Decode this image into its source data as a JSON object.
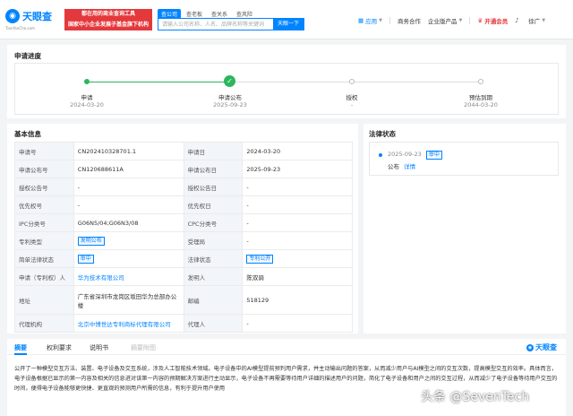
{
  "header": {
    "logo_text": "天眼查",
    "logo_sub": "TianYanCha.com",
    "banner_line1": "都在用的商业查询工具",
    "banner_line2": "国家中小企业发展子基金旗下机构",
    "search_tabs": [
      "查公司",
      "查老板",
      "查关系",
      "查风险"
    ],
    "search_placeholder": "请输入公司名称、人名、品牌名称等关键词",
    "search_button": "天眼一下",
    "nav": {
      "app": "应用",
      "business": "商务合作",
      "enterprise": "企业版产品",
      "vip": "开通会员",
      "user": "徐广"
    }
  },
  "progress": {
    "title": "申请进度",
    "steps": [
      {
        "label": "申请",
        "date": "2024-03-20"
      },
      {
        "label": "申请公布",
        "date": "2025-09-23"
      },
      {
        "label": "授权",
        "date": "-"
      },
      {
        "label": "预估到期",
        "date": "2044-03-20"
      }
    ]
  },
  "basic": {
    "title": "基本信息",
    "rows": [
      {
        "k1": "申请号",
        "v1": "CN202410328701.1",
        "k2": "申请日",
        "v2": "2024-03-20"
      },
      {
        "k1": "申请公布号",
        "v1": "CN120688611A",
        "k2": "申请公布日",
        "v2": "2025-09-23"
      },
      {
        "k1": "授权公告号",
        "v1": "-",
        "k2": "授权公告日",
        "v2": "-"
      },
      {
        "k1": "优先权号",
        "v1": "-",
        "k2": "优先权日",
        "v2": "-"
      },
      {
        "k1": "IPC分类号",
        "v1": "G06N5/04;G06N3/08",
        "k2": "CPC分类号",
        "v2": "-"
      },
      {
        "k1": "专利类型",
        "v1": "发明公布",
        "k2": "受理局",
        "v2": "-"
      },
      {
        "k1": "简单法律状态",
        "v1": "审中",
        "k2": "法律状态",
        "v2": "专利公开"
      },
      {
        "k1": "申请（专利权）人",
        "v1": "华为技术有限公司",
        "k2": "发明人",
        "v2": "陈双骑"
      },
      {
        "k1": "地址",
        "v1": "广东省深圳市龙岗区坂田华为总部办公楼",
        "k2": "邮编",
        "v2": "518129"
      },
      {
        "k1": "代理机构",
        "v1": "北京中博世达专利商标代理有限公司",
        "k2": "代理人",
        "v2": "-"
      }
    ]
  },
  "legal": {
    "title": "法律状态",
    "date": "2025-09-23",
    "badge": "审中",
    "status": "公布",
    "detail": "详情"
  },
  "tabs": {
    "items": [
      "摘要",
      "权利要求",
      "说明书",
      "摘要附图"
    ],
    "brand": "天眼查",
    "abstract": "公开了一种模型交互方法、装置、电子设备及交互系统，涉及人工智能技术领域。电子设备中的AI模型提前预判用户需求，并主动输出问题的答案，从而减少用户与AI模型之间的交互次数，提高模型交互的效率。具体而言，电子设备根据已显示的第一内容及相关的信息进对该第一内容的预期解决方案进行主动显示，电子设备不再需要等待用户详细的描述用户的问题，简化了电子设备和用户之间的交互过程，从而减少了电子设备等待用户交互的时间，便得电子设备能够更快捷、更直观的预测用户所需的信息，有利于提升用户使用"
  },
  "watermark": "头条 @SevenTech"
}
